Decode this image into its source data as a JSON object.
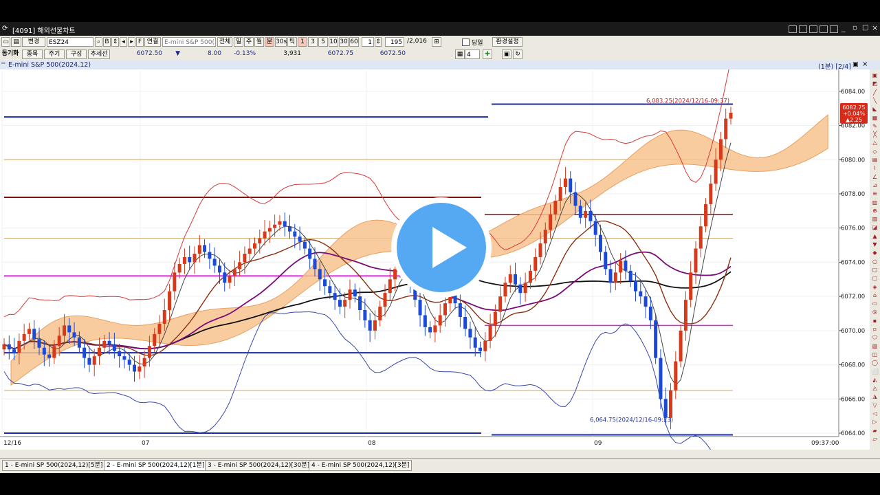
{
  "window": {
    "title": "[4091] 해외선물차트"
  },
  "toolbar": {
    "change_label": "변경",
    "symbol": "ESZ24",
    "b_label": "B",
    "f_label": "F",
    "link_label": "연결",
    "product_name": "E-mini  S&P  500(2",
    "all_label": "전체",
    "day_label": "일",
    "week_label": "주",
    "month_label": "월",
    "minute_label": "분",
    "seconds_label": "30s",
    "tick_label": "틱",
    "intervals": [
      "1",
      "3",
      "5",
      "10",
      "30",
      "60"
    ],
    "unit_value": "1",
    "count_value": "195",
    "total_value": "/2,016",
    "same_day_label": "당일",
    "settings_label": "환경설정",
    "layout_count": "4"
  },
  "quote_bar": {
    "sync_label": "동기화",
    "item_label": "종목",
    "cycle_label": "주기",
    "compose_label": "구성",
    "trend_label": "추세선",
    "price": "6072.50",
    "arrow": "▼",
    "change": "8.00",
    "change_pct": "-0.13%",
    "volume": "3,931",
    "ask": "6072.75",
    "bid": "6072.50"
  },
  "chart_header": {
    "title": "E-mini S&P 500(2024.12)",
    "period": "(1분)",
    "pane": "[2/4]"
  },
  "chart_data": {
    "type": "candlestick",
    "title": "E-mini S&P 500(2024.12)",
    "interval": "1분",
    "y_axis": {
      "ticks": [
        "6084.00",
        "6082.00",
        "6080.00",
        "6078.00",
        "6076.00",
        "6074.00",
        "6072.00",
        "6070.00",
        "6068.00",
        "6066.00",
        "6064.00"
      ],
      "range": [
        6063.8,
        6085.2
      ]
    },
    "x_axis": {
      "ticks": [
        "12/16",
        "07",
        "08",
        "09"
      ],
      "last_time": "09:37:00"
    },
    "current_price_badge": {
      "price": "6082.75",
      "pct": "+0.04%",
      "change": "▲2.25"
    },
    "annotations": [
      {
        "text": "6,083.25(2024/12/16-09:37)",
        "price": 6083.25
      },
      {
        "text": "6,064.75(2024/12/16-09:23)",
        "price": 6064.75
      }
    ],
    "close_series": [
      6069.2,
      6068.9,
      6068.7,
      6069.4,
      6069.8,
      6070.1,
      6069.5,
      6069.0,
      6068.6,
      6068.4,
      6069.1,
      6069.7,
      6070.3,
      6069.9,
      6069.6,
      6069.0,
      6068.4,
      6068.0,
      6068.5,
      6069.0,
      6069.4,
      6069.2,
      6068.8,
      6068.5,
      6068.3,
      6068.0,
      6067.6,
      6067.9,
      6068.4,
      6069.1,
      6069.8,
      6070.4,
      6071.2,
      6072.3,
      6073.4,
      6073.9,
      6074.3,
      6074.0,
      6074.5,
      6075.0,
      6074.6,
      6074.2,
      6073.8,
      6073.4,
      6072.8,
      6073.2,
      6073.6,
      6074.0,
      6074.5,
      6074.8,
      6075.1,
      6075.4,
      6075.8,
      6076.0,
      6076.2,
      6076.4,
      6076.1,
      6075.8,
      6075.5,
      6075.2,
      6074.8,
      6074.2,
      6073.6,
      6073.0,
      6072.6,
      6072.2,
      6071.8,
      6071.4,
      6071.8,
      6072.4,
      6072.0,
      6071.2,
      6070.6,
      6070.0,
      6070.6,
      6071.4,
      6072.2,
      6073.0,
      6073.6,
      6073.9,
      6073.6,
      6072.8,
      6071.8,
      6070.9,
      6070.2,
      6069.9,
      6070.3,
      6070.9,
      6071.6,
      6072.2,
      6071.6,
      6070.8,
      6070.1,
      6069.6,
      6069.0,
      6068.8,
      6069.4,
      6070.3,
      6071.1,
      6072.0,
      6072.8,
      6073.3,
      6072.7,
      6072.2,
      6072.8,
      6073.5,
      6074.3,
      6075.1,
      6075.9,
      6076.8,
      6077.6,
      6078.4,
      6078.9,
      6078.1,
      6077.3,
      6076.6,
      6077.0,
      6076.4,
      6075.6,
      6074.6,
      6073.6,
      6072.8,
      6073.4,
      6074.1,
      6073.5,
      6072.9,
      6072.3,
      6072.0,
      6071.4,
      6070.6,
      6068.4,
      6066.0,
      6064.9,
      6066.5,
      6068.2,
      6070.0,
      6071.8,
      6073.4,
      6074.8,
      6076.1,
      6077.4,
      6078.6,
      6080.0,
      6081.2,
      6082.4,
      6082.75
    ]
  }
}
